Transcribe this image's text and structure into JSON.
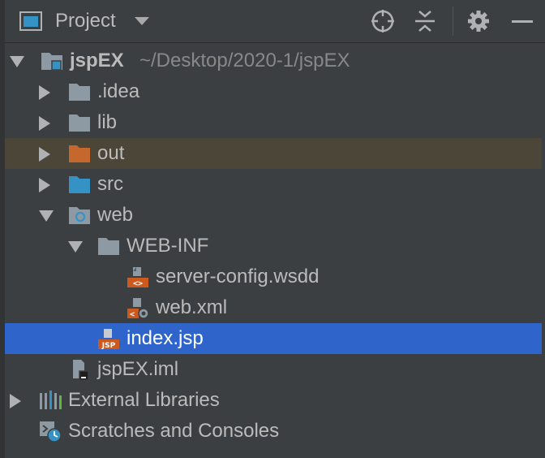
{
  "header": {
    "title": "Project",
    "icons": [
      "locate-icon",
      "collapse-all-icon",
      "gear-icon",
      "minimize-icon"
    ]
  },
  "tree": {
    "root": {
      "label": "jspEX",
      "path": "~/Desktop/2020-1/jspEX"
    },
    "idea": {
      "label": ".idea"
    },
    "lib": {
      "label": "lib"
    },
    "out": {
      "label": "out"
    },
    "src": {
      "label": "src"
    },
    "web": {
      "label": "web"
    },
    "webinf": {
      "label": "WEB-INF"
    },
    "server_config": {
      "label": "server-config.wsdd"
    },
    "web_xml": {
      "label": "web.xml"
    },
    "index_jsp": {
      "label": "index.jsp",
      "badge": "JSP"
    },
    "iml": {
      "label": "jspEX.iml"
    },
    "external": {
      "label": "External Libraries"
    },
    "scratches": {
      "label": "Scratches and Consoles"
    }
  },
  "colors": {
    "background": "#3c3f41",
    "selection": "#2f65ca",
    "highlight": "#4b4637",
    "folder_gray": "#8e9aa3",
    "folder_out": "#c5682d",
    "folder_src": "#3592c4",
    "xml_badge": "#cc5a1e"
  }
}
